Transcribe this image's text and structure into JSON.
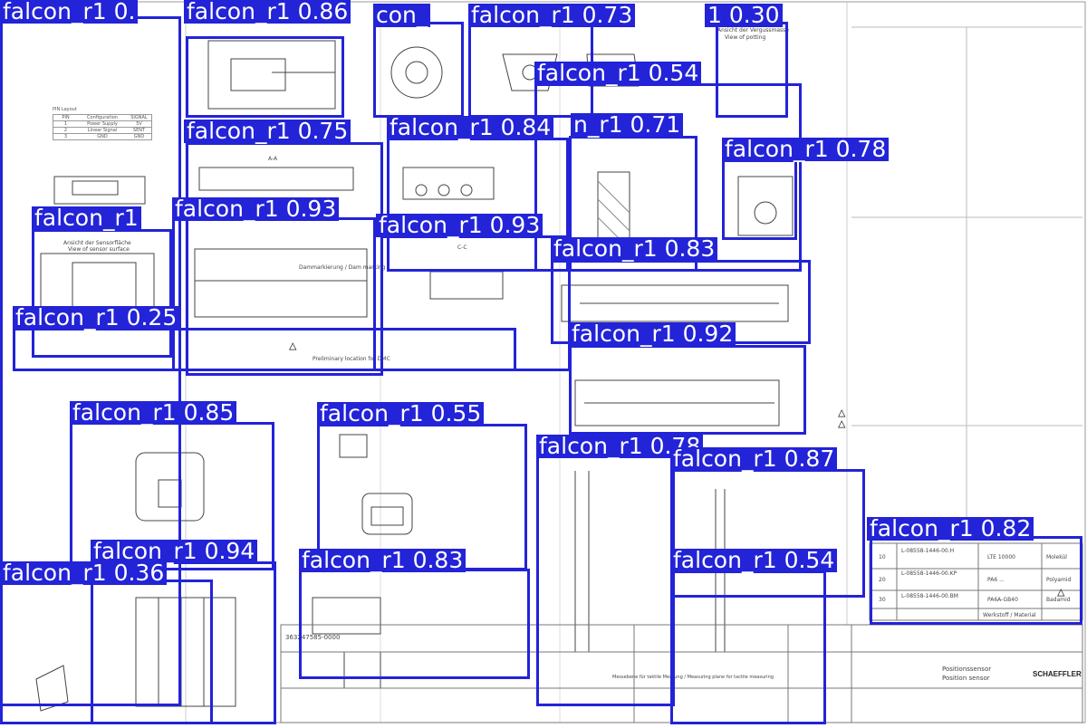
{
  "drawing": {
    "pin_layout_title": "PIN Layout",
    "pin_headers": [
      "PIN",
      "Configuration",
      "SIGNAL"
    ],
    "pin_rows": [
      [
        "1",
        "Power Supply",
        "5V"
      ],
      [
        "2",
        "Linear Signal",
        "SENT"
      ],
      [
        "3",
        "GND",
        "GND"
      ]
    ],
    "view_aa": "A-A",
    "section_cc": "C-C",
    "view_potting_de": "Ansicht der Vergussmasse",
    "view_potting_en": "View of potting",
    "sensor_face_de": "Ansicht der Sensorfläche",
    "sensor_face_en": "View of sensor surface",
    "dam_marking": "Dammarkierung / Dam marking",
    "preliminary": "Preliminary location for DMC",
    "measuring_plane": "Messebene für taktile Messung / Measuring plane for tactile measuring",
    "doc_number": "363247585-0000",
    "company": "SCHAEFFLER",
    "part_de": "Positionssensor",
    "part_en": "Position sensor",
    "bom_rows": [
      [
        "10",
        "L-08558-1446-00.H",
        "LTE 10000",
        "Molekül"
      ],
      [
        "20",
        "L-08558-1446-00.KP",
        "PA6 ...",
        "Polyamid"
      ],
      [
        "30",
        "L-08558-1446-00.BM",
        "PA6A-GB40",
        "Badamid"
      ]
    ],
    "material_col": "Werkstoff / Material"
  },
  "detections": [
    {
      "label": "falcon_r1 0.",
      "color": "#2323d8"
    },
    {
      "label": "falcon_r1 0.86",
      "color": "#2323d8"
    },
    {
      "label": "con_",
      "color": "#2323d8"
    },
    {
      "label": "falcon_r1 0.73",
      "color": "#2323d8"
    },
    {
      "label": "1 0.30",
      "color": "#2323d8"
    },
    {
      "label": "falcon_r1 0.54",
      "color": "#2323d8"
    },
    {
      "label": "falcon_r1 0.75",
      "color": "#2323d8"
    },
    {
      "label": "falcon_r1 0.84",
      "color": "#2323d8"
    },
    {
      "label": "n_r1 0.71",
      "color": "#2323d8"
    },
    {
      "label": "falcon_r1 0.78",
      "color": "#2323d8"
    },
    {
      "label": "falcon_r1 0.93",
      "color": "#2323d8"
    },
    {
      "label": "falcon_r1",
      "color": "#2323d8"
    },
    {
      "label": "falcon_r1 0.93",
      "color": "#2323d8"
    },
    {
      "label": "falcon_r1 0.83",
      "color": "#2323d8"
    },
    {
      "label": "falcon_r1 0.25",
      "color": "#2323d8"
    },
    {
      "label": "falcon_r1 0.92",
      "color": "#2323d8"
    },
    {
      "label": "falcon_r1 0.85",
      "color": "#2323d8"
    },
    {
      "label": "falcon_r1 0.55",
      "color": "#2323d8"
    },
    {
      "label": "falcon_r1 0.78",
      "color": "#2323d8"
    },
    {
      "label": "falcon_r1 0.87",
      "color": "#2323d8"
    },
    {
      "label": "falcon_r1 0.82",
      "color": "#2323d8"
    },
    {
      "label": "falcon_r1 0.94",
      "color": "#2323d8"
    },
    {
      "label": "falcon_r1 0.36",
      "color": "#2323d8"
    },
    {
      "label": "falcon_r1 0.83",
      "color": "#2323d8"
    },
    {
      "label": "falcon_r1 0.54",
      "color": "#2323d8"
    }
  ]
}
